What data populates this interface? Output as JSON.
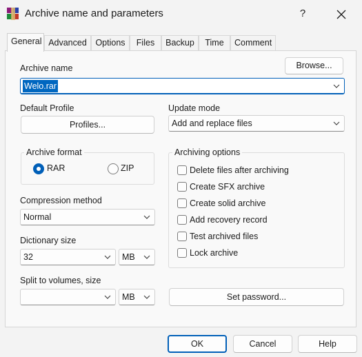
{
  "window": {
    "title": "Archive name and parameters"
  },
  "tabs": [
    "General",
    "Advanced",
    "Options",
    "Files",
    "Backup",
    "Time",
    "Comment"
  ],
  "archive_name": {
    "label": "Archive name",
    "value": "Welo.rar",
    "browse_label": "Browse..."
  },
  "profile": {
    "label": "Default Profile",
    "button_label": "Profiles..."
  },
  "update_mode": {
    "label": "Update mode",
    "value": "Add and replace files"
  },
  "archive_format": {
    "label": "Archive format",
    "options": [
      "RAR",
      "ZIP"
    ],
    "selected": "RAR"
  },
  "archiving_options": {
    "label": "Archiving options",
    "items": [
      {
        "label": "Delete files after archiving",
        "checked": false
      },
      {
        "label": "Create SFX archive",
        "checked": false
      },
      {
        "label": "Create solid archive",
        "checked": false
      },
      {
        "label": "Add recovery record",
        "checked": false
      },
      {
        "label": "Test archived files",
        "checked": false
      },
      {
        "label": "Lock archive",
        "checked": false
      }
    ]
  },
  "compression": {
    "label": "Compression method",
    "value": "Normal"
  },
  "dictionary": {
    "label": "Dictionary size",
    "value": "32",
    "unit": "MB"
  },
  "split": {
    "label": "Split to volumes, size",
    "value": "",
    "unit": "MB"
  },
  "password_label": "Set password...",
  "buttons": {
    "ok": "OK",
    "cancel": "Cancel",
    "help": "Help"
  },
  "colors": {
    "accent": "#005fb8",
    "background": "#f3f3f3"
  }
}
